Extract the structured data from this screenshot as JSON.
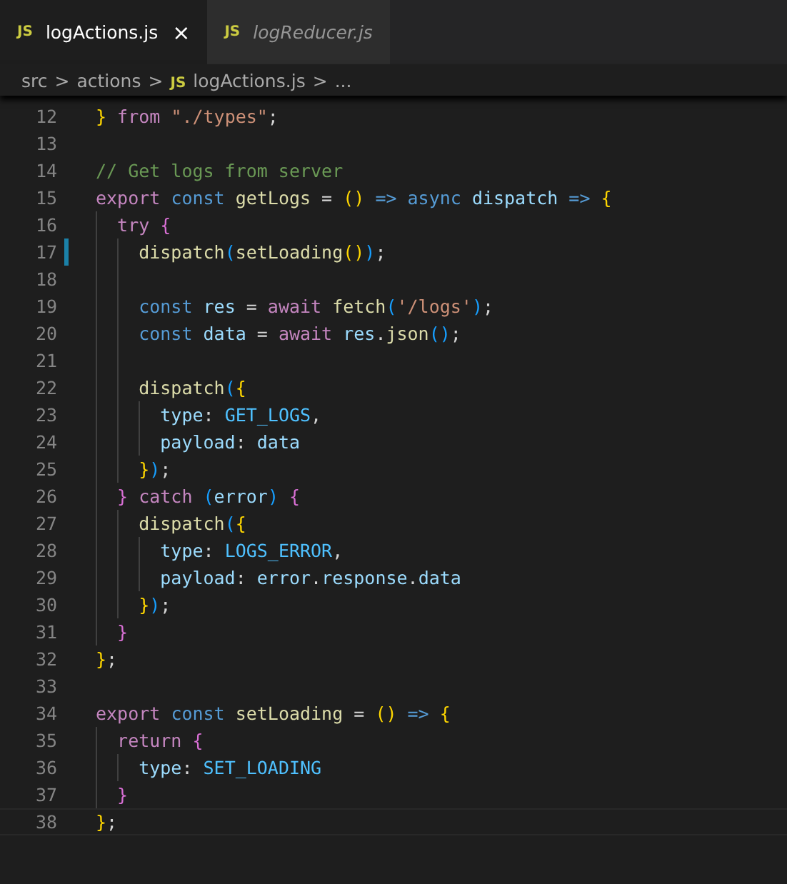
{
  "tabs": [
    {
      "badge": "JS",
      "label": "logActions.js",
      "selected": true,
      "preview": false,
      "close": "×"
    },
    {
      "badge": "JS",
      "label": "logReducer.js",
      "selected": false,
      "preview": true
    }
  ],
  "breadcrumb": [
    {
      "label": "src",
      "kind": "folder"
    },
    {
      "label": "actions",
      "kind": "folder"
    },
    {
      "label": "logActions.js",
      "kind": "file",
      "badge": "JS"
    },
    {
      "label": "...",
      "kind": "more"
    }
  ],
  "separator": ">",
  "lines": [
    {
      "number": "12",
      "tokens": [
        {
          "t": "}",
          "kind": "bracket1"
        },
        {
          "t": " from ",
          "kind": "keyword"
        },
        {
          "t": "\"./types\"",
          "kind": "string"
        },
        {
          "t": ";",
          "kind": "plain"
        }
      ]
    },
    {
      "number": "13"
    },
    {
      "number": "14",
      "tokens": [
        {
          "t": "// Get logs from server",
          "kind": "comment"
        }
      ]
    },
    {
      "number": "15",
      "tokens": [
        {
          "t": "export ",
          "kind": "keyword"
        },
        {
          "t": "const ",
          "kind": "storage"
        },
        {
          "t": "getLogs",
          "kind": "function"
        },
        {
          "t": " = ",
          "kind": "plain"
        },
        {
          "t": "()",
          "kind": "bracket1"
        },
        {
          "t": " => async ",
          "kind": "storage"
        },
        {
          "t": "dispatch",
          "kind": "variable"
        },
        {
          "t": " => ",
          "kind": "storage"
        },
        {
          "t": "{",
          "kind": "bracket1"
        }
      ]
    },
    {
      "number": "16",
      "tokens": [
        {
          "t": "  try ",
          "kind": "keyword"
        },
        {
          "t": "{",
          "kind": "bracket2"
        }
      ]
    },
    {
      "number": "17",
      "modified": true,
      "tokens": [
        {
          "t": "    dispatch",
          "kind": "function"
        },
        {
          "t": "(",
          "kind": "bracket3"
        },
        {
          "t": "setLoading",
          "kind": "function"
        },
        {
          "t": "()",
          "kind": "bracket1"
        },
        {
          "t": ")",
          "kind": "bracket3"
        },
        {
          "t": ";",
          "kind": "plain"
        }
      ]
    },
    {
      "number": "18"
    },
    {
      "number": "19",
      "tokens": [
        {
          "t": "    const ",
          "kind": "storage"
        },
        {
          "t": "res",
          "kind": "variable"
        },
        {
          "t": " = ",
          "kind": "plain"
        },
        {
          "t": "await ",
          "kind": "keyword"
        },
        {
          "t": "fetch",
          "kind": "function"
        },
        {
          "t": "(",
          "kind": "bracket3"
        },
        {
          "t": "'/logs'",
          "kind": "string"
        },
        {
          "t": ")",
          "kind": "bracket3"
        },
        {
          "t": ";",
          "kind": "plain"
        }
      ]
    },
    {
      "number": "20",
      "tokens": [
        {
          "t": "    const ",
          "kind": "storage"
        },
        {
          "t": "data",
          "kind": "variable"
        },
        {
          "t": " = ",
          "kind": "plain"
        },
        {
          "t": "await ",
          "kind": "keyword"
        },
        {
          "t": "res",
          "kind": "variable"
        },
        {
          "t": ".",
          "kind": "plain"
        },
        {
          "t": "json",
          "kind": "function"
        },
        {
          "t": "()",
          "kind": "bracket3"
        },
        {
          "t": ";",
          "kind": "plain"
        }
      ]
    },
    {
      "number": "21"
    },
    {
      "number": "22",
      "tokens": [
        {
          "t": "    dispatch",
          "kind": "function"
        },
        {
          "t": "(",
          "kind": "bracket3"
        },
        {
          "t": "{",
          "kind": "bracket1"
        }
      ]
    },
    {
      "number": "23",
      "tokens": [
        {
          "t": "      type",
          "kind": "variable"
        },
        {
          "t": ": ",
          "kind": "plain"
        },
        {
          "t": "GET_LOGS",
          "kind": "constant"
        },
        {
          "t": ",",
          "kind": "plain"
        }
      ]
    },
    {
      "number": "24",
      "tokens": [
        {
          "t": "      payload",
          "kind": "variable"
        },
        {
          "t": ": ",
          "kind": "plain"
        },
        {
          "t": "data",
          "kind": "variable"
        }
      ]
    },
    {
      "number": "25",
      "tokens": [
        {
          "t": "    }",
          "kind": "bracket1"
        },
        {
          "t": ")",
          "kind": "bracket3"
        },
        {
          "t": ";",
          "kind": "plain"
        }
      ]
    },
    {
      "number": "26",
      "tokens": [
        {
          "t": "  }",
          "kind": "bracket2"
        },
        {
          "t": " catch ",
          "kind": "keyword"
        },
        {
          "t": "(",
          "kind": "bracket3"
        },
        {
          "t": "error",
          "kind": "variable"
        },
        {
          "t": ")",
          "kind": "bracket3"
        },
        {
          "t": " {",
          "kind": "bracket2"
        }
      ]
    },
    {
      "number": "27",
      "tokens": [
        {
          "t": "    dispatch",
          "kind": "function"
        },
        {
          "t": "(",
          "kind": "bracket3"
        },
        {
          "t": "{",
          "kind": "bracket1"
        }
      ]
    },
    {
      "number": "28",
      "tokens": [
        {
          "t": "      type",
          "kind": "variable"
        },
        {
          "t": ": ",
          "kind": "plain"
        },
        {
          "t": "LOGS_ERROR",
          "kind": "constant"
        },
        {
          "t": ",",
          "kind": "plain"
        }
      ]
    },
    {
      "number": "29",
      "tokens": [
        {
          "t": "      payload",
          "kind": "variable"
        },
        {
          "t": ": ",
          "kind": "plain"
        },
        {
          "t": "error",
          "kind": "variable"
        },
        {
          "t": ".",
          "kind": "plain"
        },
        {
          "t": "response",
          "kind": "variable"
        },
        {
          "t": ".",
          "kind": "plain"
        },
        {
          "t": "data",
          "kind": "variable"
        }
      ]
    },
    {
      "number": "30",
      "tokens": [
        {
          "t": "    }",
          "kind": "bracket1"
        },
        {
          "t": ")",
          "kind": "bracket3"
        },
        {
          "t": ";",
          "kind": "plain"
        }
      ]
    },
    {
      "number": "31",
      "tokens": [
        {
          "t": "  }",
          "kind": "bracket2"
        }
      ]
    },
    {
      "number": "32",
      "tokens": [
        {
          "t": "}",
          "kind": "bracket1"
        },
        {
          "t": ";",
          "kind": "plain"
        }
      ]
    },
    {
      "number": "33"
    },
    {
      "number": "34",
      "tokens": [
        {
          "t": "export ",
          "kind": "keyword"
        },
        {
          "t": "const ",
          "kind": "storage"
        },
        {
          "t": "setLoading",
          "kind": "function"
        },
        {
          "t": " = ",
          "kind": "plain"
        },
        {
          "t": "()",
          "kind": "bracket1"
        },
        {
          "t": " => ",
          "kind": "storage"
        },
        {
          "t": "{",
          "kind": "bracket1"
        }
      ]
    },
    {
      "number": "35",
      "tokens": [
        {
          "t": "  return ",
          "kind": "keyword"
        },
        {
          "t": "{",
          "kind": "bracket2"
        }
      ]
    },
    {
      "number": "36",
      "tokens": [
        {
          "t": "    type",
          "kind": "variable"
        },
        {
          "t": ": ",
          "kind": "plain"
        },
        {
          "t": "SET_LOADING",
          "kind": "constant"
        }
      ]
    },
    {
      "number": "37",
      "tokens": [
        {
          "t": "  }",
          "kind": "bracket2"
        }
      ]
    },
    {
      "number": "38",
      "current": true,
      "tokens": [
        {
          "t": "}",
          "kind": "bracket1"
        },
        {
          "t": ";",
          "kind": "plain"
        }
      ]
    }
  ]
}
